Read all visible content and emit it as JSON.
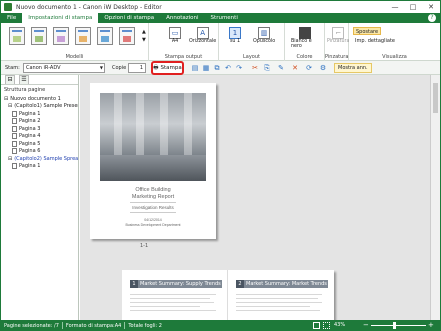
{
  "window": {
    "title": "Nuovo documento 1 - Canon iW Desktop - Editor",
    "buttons": [
      "—",
      "□",
      "✕"
    ]
  },
  "ribbon_tabs": [
    {
      "label": "File",
      "active": false
    },
    {
      "label": "Impostazioni di stampa",
      "active": true
    },
    {
      "label": "Opzioni di stampa",
      "active": false
    },
    {
      "label": "Annotazioni",
      "active": false
    },
    {
      "label": "Strumenti",
      "active": false
    }
  ],
  "help_label": "?",
  "ribbon": {
    "groups": {
      "modelli": "Modelli",
      "stampa_output": "Stampa output",
      "layout": "Layout",
      "colore": "Colore",
      "pinzatura": "Pinzatura",
      "visualizza": "Visualizza"
    },
    "paper_size": "A4",
    "orientation": "Orizzontale",
    "layout_value": "1",
    "layout_sub": "su 1",
    "duplex": "Opuscolo",
    "color_mode": "Bianco e nero",
    "stapling": "Pinzatura",
    "view_move": "Spostare",
    "view_settings": "Imp. dettagliate"
  },
  "toolbar": {
    "stampante_label": "Stam:",
    "printer": "Canon iR-ADV",
    "copies_label": "Copie",
    "copies": "1",
    "print_button": "Stampa",
    "show_ann": "Mostra ann."
  },
  "sidebar": {
    "title": "Struttura pagine",
    "items": [
      {
        "label": "Nuovo documento 1",
        "type": "doc",
        "indent": 0
      },
      {
        "label": "(Capitolo1) Sample Presentation",
        "type": "chapter",
        "indent": 1
      },
      {
        "label": "Pagina 1",
        "type": "page",
        "indent": 2
      },
      {
        "label": "Pagina 2",
        "type": "page",
        "indent": 2
      },
      {
        "label": "Pagina 3",
        "type": "page",
        "indent": 2
      },
      {
        "label": "Pagina 4",
        "type": "page",
        "indent": 2
      },
      {
        "label": "Pagina 5",
        "type": "page",
        "indent": 2
      },
      {
        "label": "Pagina 6",
        "type": "page",
        "indent": 2
      },
      {
        "label": "(Capitolo2) Sample Spread Or",
        "type": "chapter-blue",
        "indent": 1
      },
      {
        "label": "Pagina 1",
        "type": "page",
        "indent": 2
      }
    ]
  },
  "preview": {
    "page1": {
      "title_line1": "Office Building",
      "title_line2": "Marketing Report",
      "subtitle": "Investigation Results",
      "date": "04/12/2014",
      "department": "Business Development Department"
    },
    "page_label": "1-1",
    "spread_left_num": "1",
    "spread_left_title": "Market Summary: Supply Trends",
    "spread_right_num": "2",
    "spread_right_title": "Market Summary: Market Trends"
  },
  "status": {
    "selected": "Pagine selezionate: /7",
    "format": "Formato di stampa:A4",
    "sheets": "Totale fogli: 2",
    "zoom": "43%"
  }
}
